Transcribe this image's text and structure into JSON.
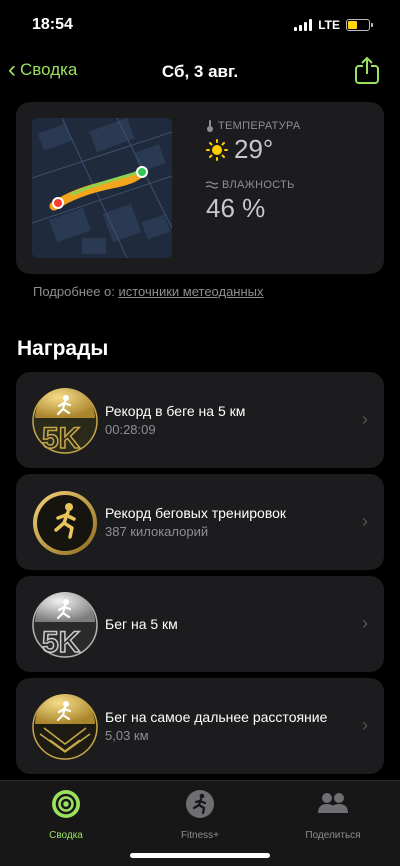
{
  "status": {
    "time": "18:54",
    "network": "LTE",
    "battery_percent": 45,
    "battery_color": "#ffd60a"
  },
  "nav": {
    "back_label": "Сводка",
    "title": "Сб, 3 авг."
  },
  "weather": {
    "temperature_label": "ТЕМПЕРАТУРА",
    "temperature_value": "29°",
    "humidity_label": "ВЛАЖНОСТЬ",
    "humidity_value": "46 %",
    "more_prefix": "Подробнее о: ",
    "more_link": "источники метеоданных"
  },
  "awards_title": "Награды",
  "awards": [
    {
      "title": "Рекорд в беге на 5 км",
      "subtitle": "00:28:09",
      "medal": "gold-5k-medal"
    },
    {
      "title": "Рекорд беговых тренировок",
      "subtitle": "387 килокалорий",
      "medal": "gold-runner-medal"
    },
    {
      "title": "Бег на 5 км",
      "subtitle": "",
      "medal": "silver-5k-medal"
    },
    {
      "title": "Бег на самое дальнее расстояние",
      "subtitle": "5,03 км",
      "medal": "gold-distance-medal"
    }
  ],
  "tabs": [
    {
      "label": "Сводка",
      "icon": "activity-rings-icon",
      "active": true
    },
    {
      "label": "Fitness+",
      "icon": "fitness-plus-icon",
      "active": false
    },
    {
      "label": "Поделиться",
      "icon": "sharing-icon",
      "active": false
    }
  ],
  "colors": {
    "accent": "#9be15d",
    "card": "#1c1c1e",
    "gold": "#c8a74a",
    "silver": "#b5b5b5"
  }
}
